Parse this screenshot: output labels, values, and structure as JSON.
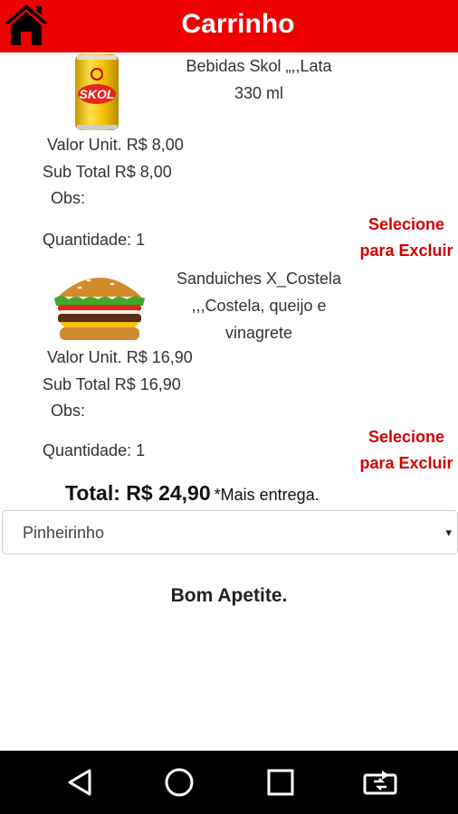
{
  "header": {
    "title": "Carrinho",
    "home_icon": "home-icon",
    "color": "#ee0000"
  },
  "cart": {
    "items": [
      {
        "image_icon": "beer-can-image",
        "name_line1": "Bebidas Skol  „,,Lata",
        "name_line2": "330 ml",
        "unit_price": "Valor Unit. R$ 8,00",
        "subtotal": "Sub Total  R$ 8,00",
        "obs": "Obs:",
        "quantity": "Quantidade: 1",
        "delete_line1": "Selecione",
        "delete_line2": "para Excluir"
      },
      {
        "image_icon": "burger-image",
        "name_line1": "Sanduiches X_Costela",
        "name_line2": ",,,Costela, queijo e",
        "name_line3": "vinagrete",
        "unit_price": "Valor Unit. R$ 16,90",
        "subtotal": "Sub Total  R$ 16,90",
        "obs": "Obs:",
        "quantity": "Quantidade: 1",
        "delete_line1": "Selecione",
        "delete_line2": "para Excluir"
      }
    ],
    "total": "Total: R$ 24,90",
    "total_note": "*Mais entrega."
  },
  "delivery_select": {
    "value": "Pinheirinho",
    "arrow": "▾"
  },
  "footer_message": "Bom Apetite.",
  "navbar": {
    "buttons": [
      "back-icon",
      "home-circle-icon",
      "recents-icon",
      "rotate-icon"
    ]
  }
}
